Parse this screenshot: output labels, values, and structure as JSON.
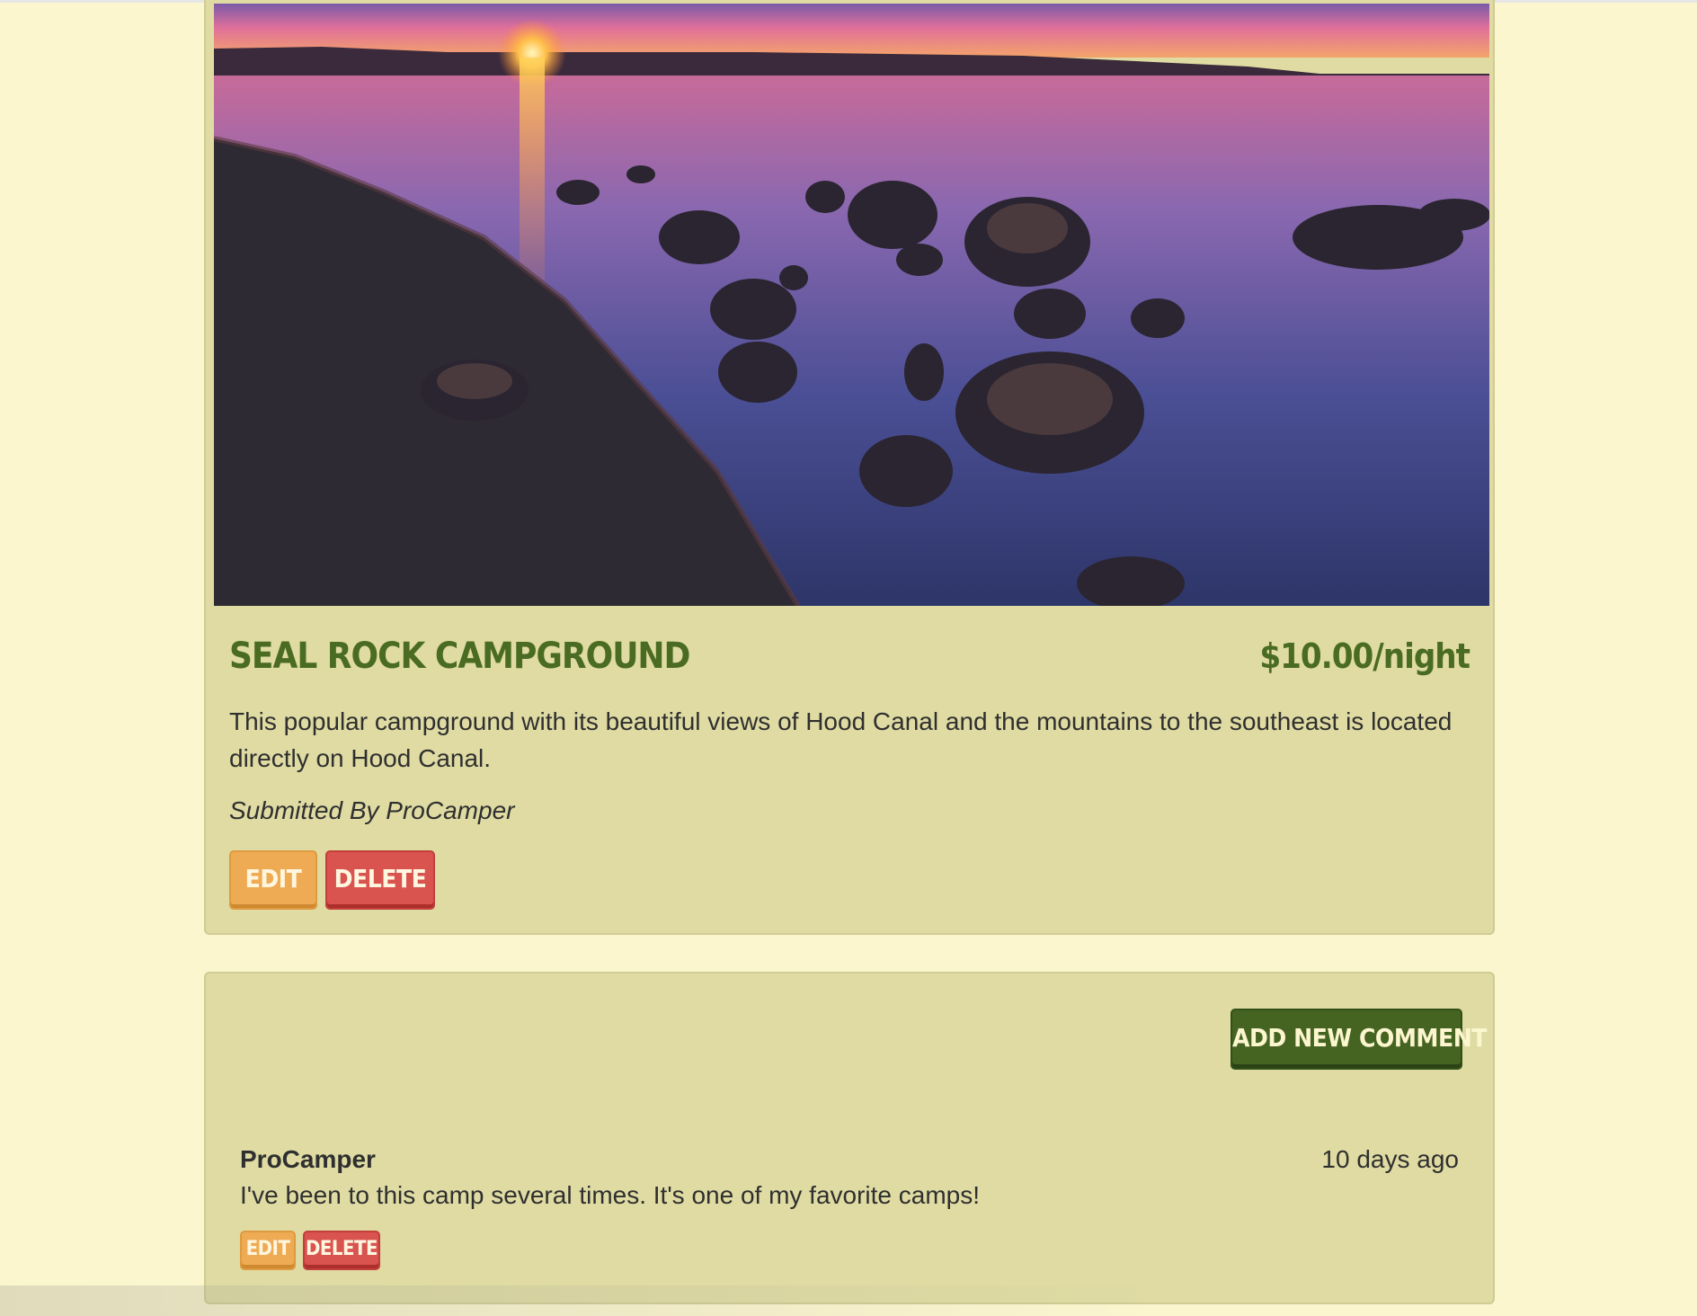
{
  "campground": {
    "photo_alt_icon": "sunset-lake-photo",
    "name": "SEAL ROCK CAMPGROUND",
    "price": "$10.00/night",
    "description": "This popular campground with its beautiful views of Hood Canal and the mountains to the southeast is located directly on Hood Canal.",
    "submitted_by": "Submitted By ProCamper",
    "edit_label": "EDIT",
    "delete_label": "DELETE"
  },
  "comments": {
    "add_label": "ADD NEW COMMENT",
    "items": [
      {
        "author": "ProCamper",
        "time": "10 days ago",
        "text": "I've been to this camp several times. It's one of my favorite camps!",
        "edit_label": "EDIT",
        "delete_label": "DELETE"
      }
    ]
  },
  "colors": {
    "page_background": "#fcf6cf",
    "card_background": "#dfdba3",
    "title_green": "#4a6b22",
    "edit_orange": "#efab53",
    "delete_red": "#d9534f",
    "add_comment_green": "#456321"
  }
}
